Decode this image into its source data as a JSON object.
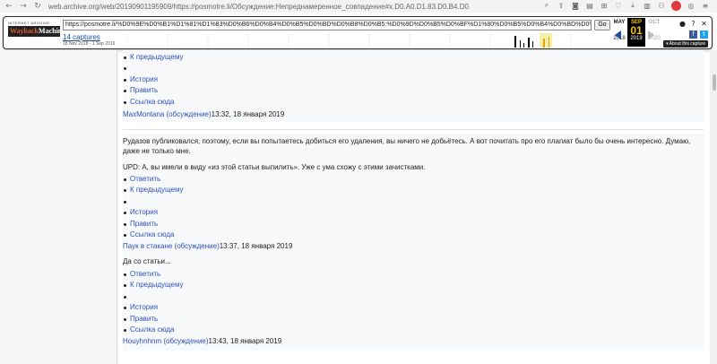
{
  "browser": {
    "back_icon": "back-arrow-icon",
    "forward_icon": "forward-arrow-icon",
    "reload_icon": "reload-icon",
    "url": "web.archive.org/web/20190901195909/https://posmotre.li/Обсуждение:Непреднамеренное_совпадение#x.D0.A0.D1.83.D0.B4.D0.B0.D0.B7.D0.BE.D0.B2_.D0.B8_.D0.92.D0.B0.D0"
  },
  "wayback": {
    "logo_top": "INTERNET ARCHIVE",
    "logo_main_a": "Wayback",
    "logo_main_b": "Machine",
    "url_value": "https://posmotre.li/%D0%9E%D0%B1%D1%81%D1%83%D0%B6%D0%B4%D0%B5%D0%BD%D0%B8%D0%B5:%D0%9D%D0%B5%D0%BF%D1%80%D0%B5%D0%B4%D0%BD%D0%B0%D0%BC%D0%B5%D1%80",
    "go_label": "Go",
    "captures_label": "14 captures",
    "range_label": "18 Nov 2018 - 1 Sep 2019",
    "prev_month": "MAY",
    "prev_year": "2018",
    "current_month": "SEP",
    "current_day": "01",
    "current_year": "2019",
    "next_month": "OCT",
    "next_year": "2020",
    "about_label": "▾ About this capture"
  },
  "comments": [
    {
      "text": "",
      "actions": [
        "К предыдущему",
        "",
        "История",
        "Править",
        "Ссылка сюда"
      ],
      "author": "MaxMontana",
      "talk": "(обсуждение)",
      "time": "13:32, 18 января 2019"
    },
    {
      "text": "Рудазов публиковался, поэтому, если вы попытаетесь добиться его удаления, вы ничего не добьётесь. А вот почитать про его плагиат было бы очень интересно. Думаю, даже не только мне.",
      "text2": "UPD: А, вы имели в виду «из этой статьи выпилить». Уже с ума схожу с этими зачистками.",
      "actions": [
        "Ответить",
        "К предыдущему",
        "",
        "История",
        "Править",
        "Ссылка сюда"
      ],
      "author": "Паук в стакане",
      "talk": "(обсуждение)",
      "time": "13:37, 18 января 2019"
    },
    {
      "text": "Да со статьи...",
      "actions": [
        "Ответить",
        "К предыдущему",
        "",
        "История",
        "Править",
        "Ссылка сюда"
      ],
      "author": "Houyhnhnm",
      "talk": "(обсуждение)",
      "time": "13:43, 18 января 2019"
    }
  ]
}
